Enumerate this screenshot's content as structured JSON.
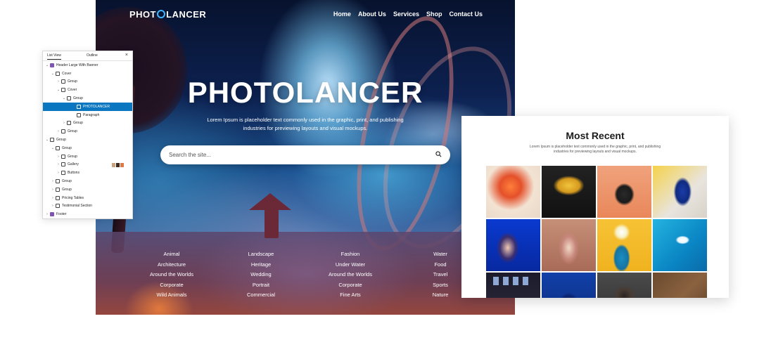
{
  "site": {
    "logo_part1": "PHOT",
    "logo_part2": "LANCER",
    "nav": [
      "Home",
      "About Us",
      "Services",
      "Shop",
      "Contact Us"
    ],
    "hero_title": "PHOTOLANCER",
    "hero_subtitle": "Lorem Ipsum is placeholder text commonly used in the graphic, print, and publishing industries for previewing layouts and visual mockups.",
    "search_placeholder": "Search the site...",
    "categories": [
      [
        "Animal",
        "Architecture",
        "Around the Worlds",
        "Corporate",
        "Wild Animals"
      ],
      [
        "Landscape",
        "Heritage",
        "Wedding",
        "Portrait",
        "Commercial"
      ],
      [
        "Fashion",
        "Under Water",
        "Around the Worlds",
        "Corporate",
        "Fine Arts"
      ],
      [
        "Water",
        "Food",
        "Travel",
        "Sports",
        "Nature"
      ]
    ],
    "accent": "#3fb6ff"
  },
  "list_view": {
    "tabs": [
      "List View",
      "Outline"
    ],
    "close_label": "×",
    "rows": [
      {
        "label": "Header Large With Banner",
        "expanded": true,
        "icon": "template-icon"
      },
      {
        "label": "Cover",
        "expanded": true,
        "icon": "cover-icon"
      },
      {
        "label": "Group",
        "expanded": false,
        "icon": "group-icon"
      },
      {
        "label": "Cover",
        "expanded": true,
        "icon": "cover-icon"
      },
      {
        "label": "Group",
        "expanded": true,
        "icon": "group-icon"
      },
      {
        "label": "PHOTOLANCER",
        "expanded": null,
        "icon": "heading-icon",
        "selected": true
      },
      {
        "label": "Paragraph",
        "expanded": null,
        "icon": "paragraph-icon"
      },
      {
        "label": "Group",
        "expanded": false,
        "icon": "group-icon"
      },
      {
        "label": "Group",
        "expanded": false,
        "icon": "group-icon"
      },
      {
        "label": "Group",
        "expanded": true,
        "icon": "group-icon"
      },
      {
        "label": "Group",
        "expanded": true,
        "icon": "group-icon"
      },
      {
        "label": "Group",
        "expanded": false,
        "icon": "group-icon"
      },
      {
        "label": "Gallery",
        "expanded": false,
        "icon": "gallery-icon"
      },
      {
        "label": "Buttons",
        "expanded": false,
        "icon": "buttons-icon"
      },
      {
        "label": "Group",
        "expanded": false,
        "icon": "group-icon"
      },
      {
        "label": "Group",
        "expanded": false,
        "icon": "group-icon"
      },
      {
        "label": "Pricing Tables",
        "expanded": false,
        "icon": "group-icon"
      },
      {
        "label": "Testimonial Section",
        "expanded": false,
        "icon": "group-icon"
      },
      {
        "label": "Footer",
        "expanded": false,
        "icon": "template-icon"
      }
    ],
    "selected_color": "#0a77c0",
    "template_color": "#7f54b3"
  },
  "recent": {
    "title": "Most Recent",
    "description": "Lorem Ipsum is placeholder text commonly used in the graphic, print, and publishing industries for previewing layouts and visual mockups."
  }
}
